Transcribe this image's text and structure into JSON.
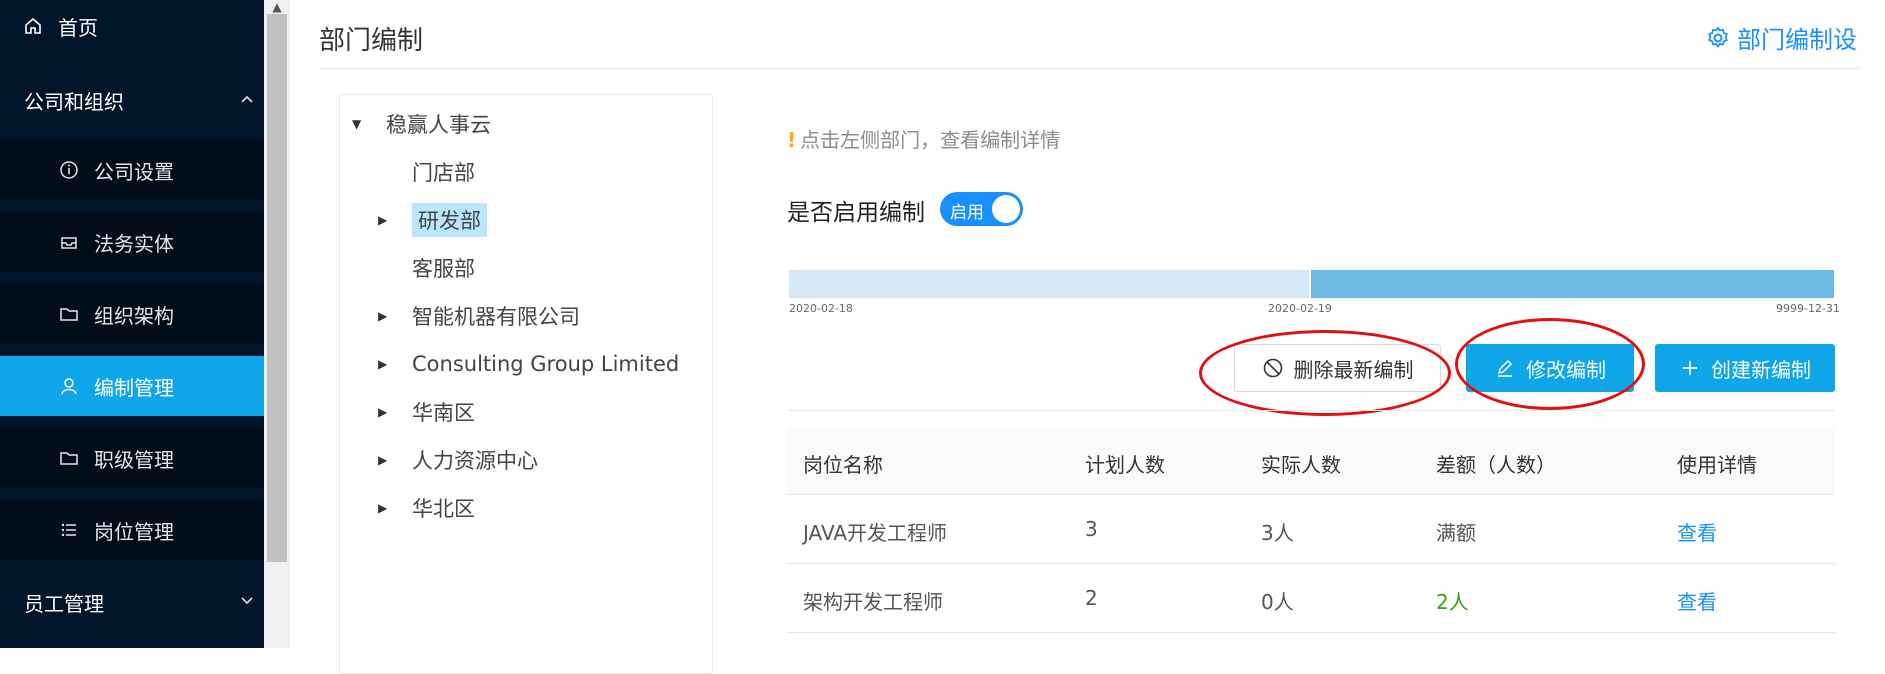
{
  "sidebar": {
    "home": {
      "label": "首页",
      "icon": "home-icon"
    },
    "company_group": {
      "label": "公司和组织",
      "icon": "chevron-up-icon"
    },
    "items": [
      {
        "label": "公司设置",
        "icon": "info-circle-icon"
      },
      {
        "label": "法务实体",
        "icon": "inbox-icon"
      },
      {
        "label": "组织架构",
        "icon": "folder-icon"
      },
      {
        "label": "编制管理",
        "icon": "user-icon",
        "active": true
      },
      {
        "label": "职级管理",
        "icon": "folder-icon"
      },
      {
        "label": "岗位管理",
        "icon": "list-icon"
      }
    ],
    "employee_group": {
      "label": "员工管理",
      "icon": "chevron-down-icon"
    }
  },
  "header": {
    "title": "部门编制",
    "settings_link": "部门编制设"
  },
  "tree": {
    "root": "稳赢人事云",
    "nodes": [
      {
        "label": "门店部",
        "has_children": false
      },
      {
        "label": "研发部",
        "has_children": true,
        "selected": true
      },
      {
        "label": "客服部",
        "has_children": false
      },
      {
        "label": "智能机器有限公司",
        "has_children": true
      },
      {
        "label": "Consulting Group Limited",
        "has_children": true
      },
      {
        "label": "华南区",
        "has_children": true
      },
      {
        "label": "人力资源中心",
        "has_children": true
      },
      {
        "label": "华北区",
        "has_children": true
      }
    ]
  },
  "detail": {
    "hint": "点击左侧部门，查看编制详情",
    "enable_label": "是否启用编制",
    "switch_text": "启用",
    "switch_on": true,
    "timeline": {
      "start": "2020-02-18",
      "mid": "2020-02-19",
      "end": "9999-12-31"
    },
    "buttons": {
      "delete": "删除最新编制",
      "edit": "修改编制",
      "create": "创建新编制"
    },
    "table": {
      "headers": [
        "岗位名称",
        "计划人数",
        "实际人数",
        "差额（人数）",
        "使用详情"
      ],
      "rows": [
        {
          "name": "JAVA开发工程师",
          "planned": "3",
          "actual": "3人",
          "diff": "满额",
          "detail": "查看"
        },
        {
          "name": "架构开发工程师",
          "planned": "2",
          "actual": "0人",
          "diff": "2人",
          "detail": "查看"
        }
      ]
    }
  },
  "colors": {
    "sidebar_bg": "#001529",
    "accent": "#0ea5e9",
    "link": "#1890ff",
    "annotation": "#e01010"
  }
}
